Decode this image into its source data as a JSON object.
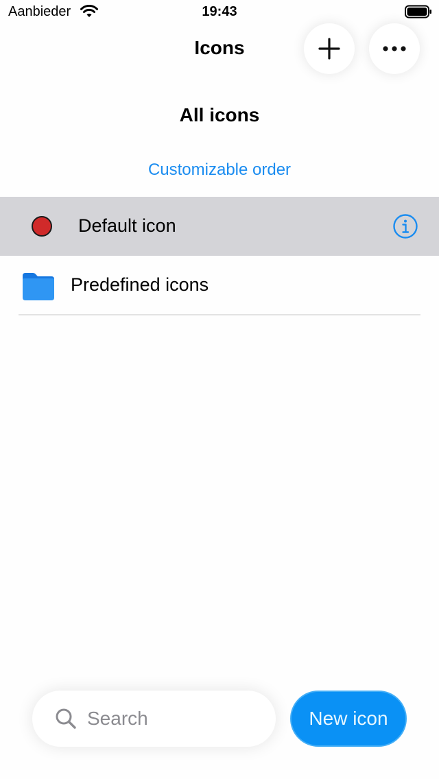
{
  "status_bar": {
    "carrier": "Aanbieder",
    "time": "19:43"
  },
  "nav": {
    "title": "Icons",
    "add_icon": "plus-icon",
    "more_icon": "ellipsis-icon"
  },
  "section": {
    "title": "All icons",
    "order_link": "Customizable order"
  },
  "list": {
    "items": [
      {
        "label": "Default icon",
        "icon": "red-circle-icon",
        "accessory": "info-icon",
        "selected": true
      },
      {
        "label": "Predefined icons",
        "icon": "folder-icon"
      }
    ]
  },
  "search": {
    "placeholder": "Search",
    "value": ""
  },
  "new_button": {
    "label": "New icon"
  },
  "colors": {
    "accent": "#1a8cf0",
    "button": "#0a91f5",
    "selected_row": "#d4d4d8",
    "red_dot": "#d02a2a"
  }
}
